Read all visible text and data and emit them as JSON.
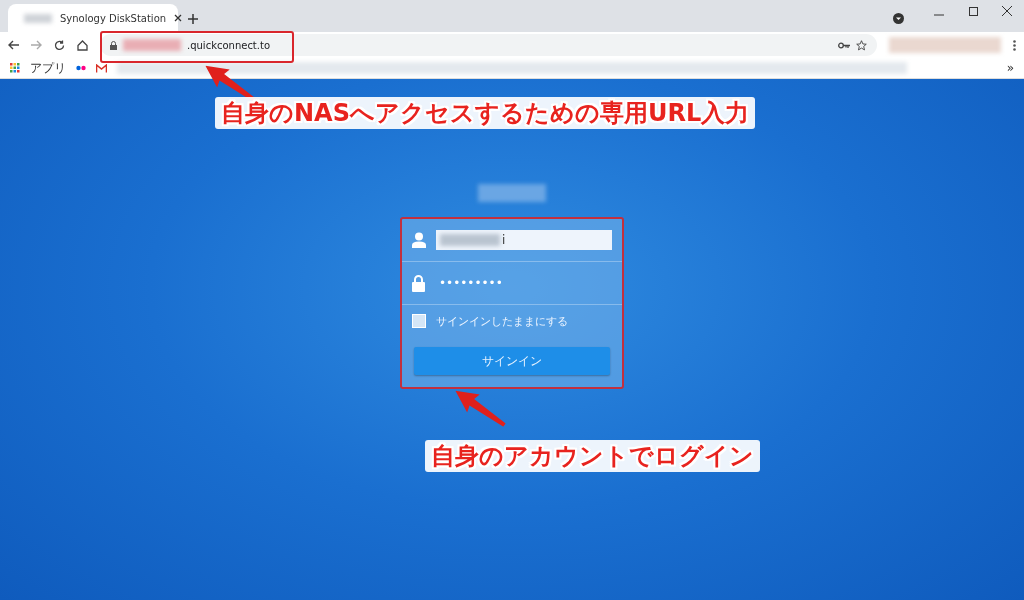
{
  "browser": {
    "tabs": [
      {
        "title": "Synology DiskStation",
        "selected": true
      }
    ],
    "address": {
      "value": ".quickconnect.to"
    },
    "bookmarks": [
      {
        "kind": "apps",
        "label": "アプリ"
      },
      {
        "kind": "dots"
      },
      {
        "kind": "mail"
      }
    ],
    "bookmarks_more": "»"
  },
  "login": {
    "username": "i",
    "password": "•••••••••",
    "remember": {
      "label": "サインインしたままにする",
      "checked": false
    },
    "submit": "サインイン"
  },
  "annotations": [
    {
      "text": "自身のNASへアクセスするための専用URL入力"
    },
    {
      "text": "自身のアカウントでログイン"
    }
  ]
}
